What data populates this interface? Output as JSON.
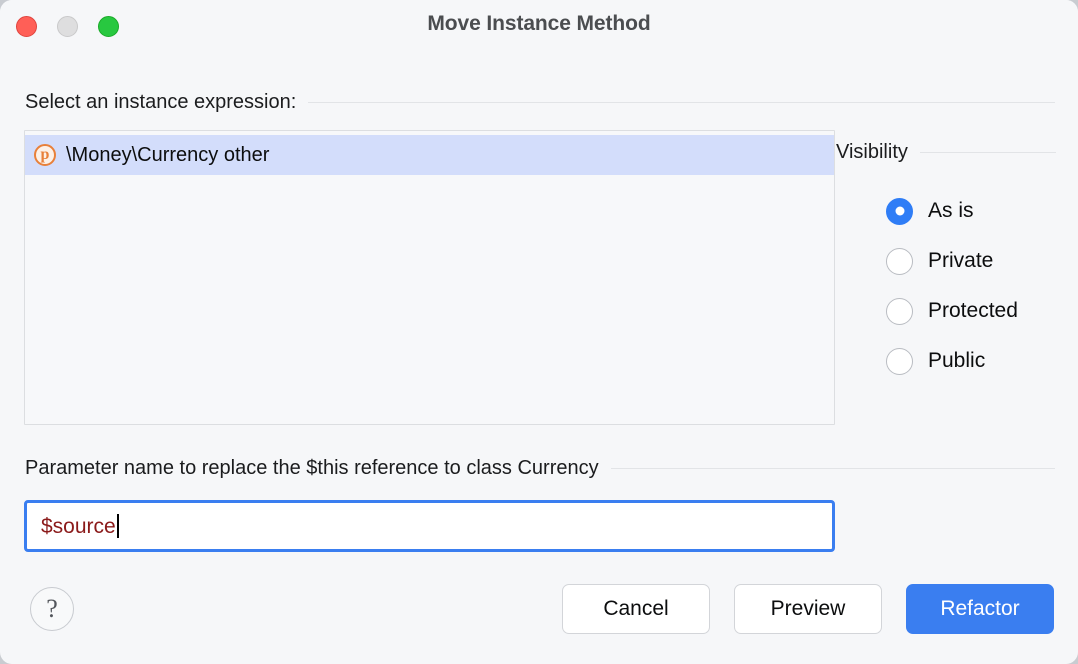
{
  "window": {
    "title": "Move Instance Method",
    "traffic_lights": [
      {
        "name": "close",
        "color": "#ff5f57"
      },
      {
        "name": "minimize",
        "color": "#dededf"
      },
      {
        "name": "maximize",
        "color": "#28c840"
      }
    ]
  },
  "expression_section": {
    "label": "Select an instance expression:",
    "items": [
      {
        "icon": "php-parameter-icon",
        "icon_glyph": "p",
        "text": "\\Money\\Currency other",
        "selected": true
      }
    ]
  },
  "visibility_section": {
    "label": "Visibility",
    "options": [
      {
        "label": "As is",
        "selected": true
      },
      {
        "label": "Private",
        "selected": false
      },
      {
        "label": "Protected",
        "selected": false
      },
      {
        "label": "Public",
        "selected": false
      }
    ]
  },
  "parameter_section": {
    "label": "Parameter name to replace the $this reference to class Currency",
    "input_value": "$source",
    "input_placeholder": ""
  },
  "footer": {
    "help_label": "?",
    "cancel_label": "Cancel",
    "preview_label": "Preview",
    "refactor_label": "Refactor"
  },
  "colors": {
    "accent": "#3a7ef0",
    "selection": "#d3ddfb",
    "php_icon": "#e8803a",
    "input_text": "#8b1a1a",
    "background": "#f6f7f9"
  }
}
